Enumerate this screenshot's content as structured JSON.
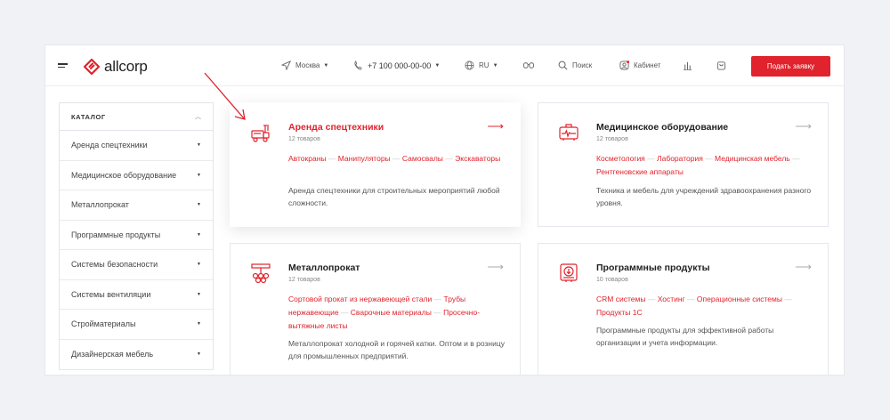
{
  "header": {
    "logo_text": "allcorp",
    "city": "Москва",
    "phone": "+7 100 000-00-00",
    "lang": "RU",
    "search_label": "Поиск",
    "cabinet_label": "Кабинет",
    "cta_label": "Подать заявку"
  },
  "sidebar": {
    "title": "КАТАЛОГ",
    "items": [
      "Аренда спецтехники",
      "Медицинское оборудование",
      "Металлопрокат",
      "Программные продукты",
      "Системы безопасности",
      "Системы вентиляции",
      "Стройматериалы",
      "Дизайнерская мебель"
    ]
  },
  "cards": [
    {
      "title": "Аренда спецтехники",
      "count": "12 товаров",
      "tags": [
        "Автокраны",
        "Манипуляторы",
        "Самосвалы",
        "Экскаваторы"
      ],
      "desc": "Аренда спецтехники для строительных мероприятий любой сложности.",
      "icon": "crane-truck-icon"
    },
    {
      "title": "Медицинское оборудование",
      "count": "12 товаров",
      "tags": [
        "Косметология",
        "Лаборатория",
        "Медицинская мебель",
        "Рентгеновские аппараты"
      ],
      "desc": "Техника и мебель для учреждений здравоохранения разного уровня.",
      "icon": "medical-device-icon"
    },
    {
      "title": "Металлопрокат",
      "count": "12 товаров",
      "tags": [
        "Сортовой прокат из нержавеющей стали",
        "Трубы нержавеющие",
        "Сварочные материалы",
        "Просечно-вытяжные листы"
      ],
      "desc": "Металлопрокат холодной и горячей катки. Оптом и в розницу для промышленных предприятий.",
      "icon": "metal-pipes-icon"
    },
    {
      "title": "Программные продукты",
      "count": "10 товаров",
      "tags": [
        "CRM системы",
        "Хостинг",
        "Операционные системы",
        "Продукты 1С"
      ],
      "desc": "Программные продукты для эффективной работы организации и учета информации.",
      "icon": "software-download-icon"
    }
  ],
  "colors": {
    "accent": "#e0232c",
    "background": "#f1f2f6"
  }
}
